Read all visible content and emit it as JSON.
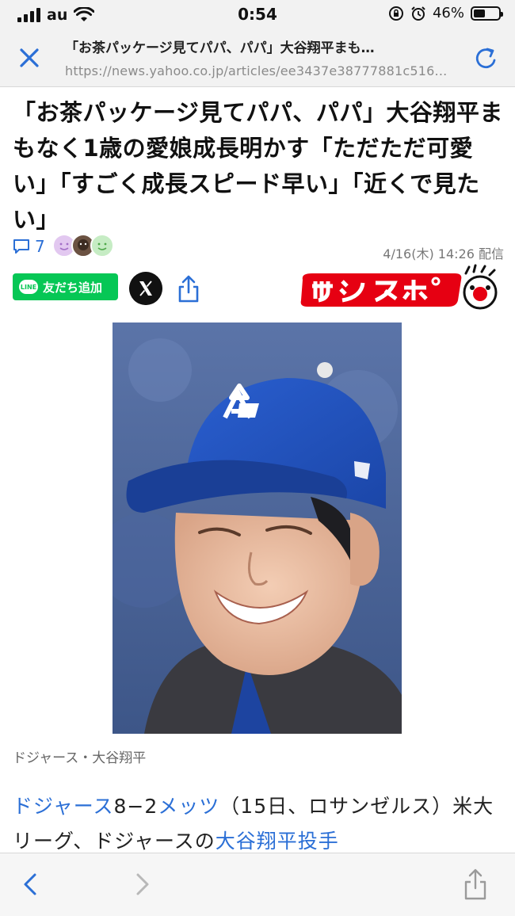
{
  "status_bar": {
    "carrier": "au",
    "time": "0:54",
    "battery": "46%",
    "battery_level": 0.46
  },
  "browser": {
    "page_title": "「お茶パッケージ見てパパ、パパ」大谷翔平まも…",
    "url": "https://news.yahoo.co.jp/articles/ee3437e38777881c516..."
  },
  "article": {
    "headline": "「お茶パッケージ見てパパ、パパ」大谷翔平まもなく1歳の愛娘成長明かす「ただただ可愛い」「すごく成長スピード早い」「近くで見たい」",
    "comment_count": "7",
    "date": "4/16(木) 14:26 配信",
    "line_button": "友だち追加",
    "line_badge": "LINE",
    "publisher_logo": "サンスポ",
    "photo_caption": "ドジャース・大谷翔平",
    "body": {
      "link1": "ドジャース",
      "text1": "8−2",
      "link2": "メッツ",
      "text2": "（15日、ロサンゼルス）米大リーグ、ドジャースの",
      "link3": "大谷翔平投手"
    }
  },
  "colors": {
    "link": "#2b6fd6",
    "line_green": "#06c755",
    "sanspo_red": "#e60012"
  },
  "icons": [
    "close-icon",
    "reload-icon",
    "comment-icon",
    "x-logo-icon",
    "share-icon",
    "back-icon",
    "forward-icon"
  ]
}
